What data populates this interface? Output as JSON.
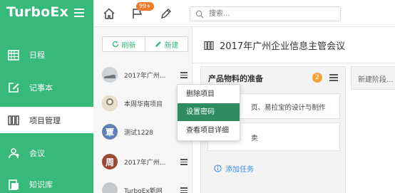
{
  "app": {
    "brand": "TurboEx",
    "accent": "#37b97a"
  },
  "sidebar": {
    "items": [
      {
        "label": "日程",
        "icon": "calendar-icon",
        "active": false
      },
      {
        "label": "记事本",
        "icon": "edit-note-icon",
        "active": false
      },
      {
        "label": "项目管理",
        "icon": "project-columns-icon",
        "active": true
      },
      {
        "label": "会议",
        "icon": "meeting-icon",
        "active": false
      },
      {
        "label": "知识库",
        "icon": "knowledge-icon",
        "active": false
      }
    ]
  },
  "topbar": {
    "icons": [
      "home-icon",
      "flag-icon",
      "pencil-icon"
    ],
    "badge": "99+",
    "search_placeholder": "搜索..."
  },
  "project_list": {
    "refresh_label": "刷新",
    "new_label": "新建",
    "projects": [
      {
        "name": "2017年广州...",
        "avatar_text": "",
        "avatar_color": "#b9bfc6"
      },
      {
        "name": "本周华南项目",
        "avatar_text": "",
        "avatar_color": "#8b7a5e"
      },
      {
        "name": "测试1228",
        "avatar_text": "覃",
        "avatar_color": "#5f7fb6"
      },
      {
        "name": "2017年广州...",
        "avatar_text": "周",
        "avatar_color": "#9a4a33"
      },
      {
        "name": "TurboEx新网",
        "avatar_text": "",
        "avatar_color": "#c4c9ce"
      }
    ]
  },
  "dropdown": {
    "items": [
      {
        "label": "删除项目",
        "selected": false
      },
      {
        "label": "设置密码",
        "selected": true
      },
      {
        "label": "查看项目详细",
        "selected": false
      }
    ]
  },
  "main": {
    "title": "2017年广州企业信息主管会议",
    "stage": {
      "name": "产品物料的准备",
      "count": "2",
      "cards": [
        "页、易拉宝的设计与制作",
        "卖"
      ],
      "add_task_label": "添加任务"
    },
    "new_stage_label": "新建阶段..."
  }
}
